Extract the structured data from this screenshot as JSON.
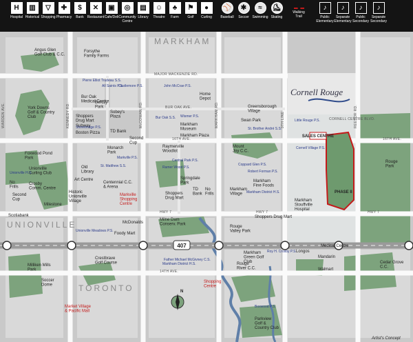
{
  "legend": [
    {
      "icon": "hospital-icon",
      "glyph": "H",
      "label": "Hospital"
    },
    {
      "icon": "historical-icon",
      "glyph": "▥",
      "label": "Historical"
    },
    {
      "icon": "shopping-cart-icon",
      "glyph": "▽",
      "label": "Shopping"
    },
    {
      "icon": "pharmacy-icon",
      "glyph": "✚",
      "label": "Pharmacy"
    },
    {
      "icon": "bank-icon",
      "glyph": "$",
      "label": "Bank"
    },
    {
      "icon": "restaurant-icon",
      "glyph": "✕",
      "label": "Restaurant"
    },
    {
      "icon": "coffee-icon",
      "glyph": "▣",
      "label": "Cafe/Deli"
    },
    {
      "icon": "community-centre-icon",
      "glyph": "◎",
      "label": "Community Centre"
    },
    {
      "icon": "library-icon",
      "glyph": "▤",
      "label": "Library"
    },
    {
      "icon": "theatre-icon",
      "glyph": "☺",
      "label": "Theatre"
    },
    {
      "icon": "farm-icon",
      "glyph": "♣",
      "label": "Farm"
    },
    {
      "icon": "golf-icon",
      "glyph": "⚑",
      "label": "Golf"
    },
    {
      "icon": "curling-icon",
      "glyph": "●",
      "label": "Curling"
    },
    {
      "icon": "baseball-icon",
      "glyph": "⚾",
      "label": "Baseball"
    },
    {
      "icon": "soccer-icon",
      "glyph": "✱",
      "label": "Soccer"
    },
    {
      "icon": "swimming-icon",
      "glyph": "≈",
      "label": "Swimming"
    },
    {
      "icon": "skating-icon",
      "glyph": "⛸",
      "label": "Skating"
    },
    {
      "icon": "walking-trail-icon",
      "glyph": "",
      "label": "Walking Trail"
    },
    {
      "icon": "public-elementary-icon",
      "glyph": "♪",
      "label": "Public Elementary"
    },
    {
      "icon": "separate-elementary-icon",
      "glyph": "♪",
      "label": "Separate Elementary"
    },
    {
      "icon": "public-secondary-icon",
      "glyph": "♪",
      "label": "Public Secondary"
    },
    {
      "icon": "separate-secondary-icon",
      "glyph": "♪",
      "label": "Separate Secondary"
    }
  ],
  "regions": {
    "markham": "MARKHAM",
    "unionville": "UNIONVILLE",
    "toronto": "TORONTO"
  },
  "brand": {
    "name": "Cornell Rouge",
    "sales_centre": "SALES CENTRE",
    "phase": "PHASE II"
  },
  "roads": {
    "major_mackenzie": "MAJOR MACKENZIE RD.",
    "bur_oak": "BUR OAK AVE.",
    "sixteenth_top": "16TH AVE.",
    "sixteenth_mid": "16TH AVE.",
    "hwy7_a": "HWY 7",
    "hwy7_b": "HWY 7",
    "hwy7_c": "HWY 7",
    "fourteenth": "14TH AVE.",
    "warden": "WARDEN AVE.",
    "kennedy": "KENNEDY RD.",
    "mccowan": "McCOWAN RD.",
    "markham_rd": "MARKHAM RD.",
    "ninth_line": "9TH LINE",
    "reesor": "REESOR RD.",
    "cornell_centre": "CORNELL CENTRE BLVD.",
    "hwy407": "407"
  },
  "places": [
    {
      "t": "Angus Glen",
      "s": "Golf Club & C.C."
    },
    {
      "t": "Forsythe",
      "s": "Family Farms"
    },
    {
      "t": "York Downs",
      "s": "Golf & Country",
      "s2": "Club"
    },
    {
      "t": "Bur Oak",
      "s": "Medical Centre"
    },
    {
      "t": "Berczy",
      "s": "Park"
    },
    {
      "t": "Home",
      "s": "Depot"
    },
    {
      "t": "Greensborough",
      "s": "Village"
    },
    {
      "t": "Swan Park"
    },
    {
      "t": "Shoppers",
      "s": "Drug Mart"
    },
    {
      "t": "Subway"
    },
    {
      "t": "Boston Pizza"
    },
    {
      "t": "Sobey's",
      "s": "Plaza"
    },
    {
      "t": "TD Bank"
    },
    {
      "t": "Second",
      "s": "Cup"
    },
    {
      "t": "Markham",
      "s": "Museum"
    },
    {
      "t": "Markham Plaza"
    },
    {
      "t": "Mount",
      "s": "Joy C.C."
    },
    {
      "t": "Monarch",
      "s": "Park"
    },
    {
      "t": "Old",
      "s": "Library"
    },
    {
      "t": "Raymerville",
      "s": "Woodlot"
    },
    {
      "t": "Springdale",
      "s": "Park"
    },
    {
      "t": "Markham",
      "s": "Fine Foods"
    },
    {
      "t": "Foxwood Pond",
      "s": "Park"
    },
    {
      "t": "Unionville",
      "s": "Curling Club"
    },
    {
      "t": "Crosby",
      "s": "Comm. Centre"
    },
    {
      "t": "No",
      "s": "Frills"
    },
    {
      "t": "Art Centre"
    },
    {
      "t": "Historic",
      "s": "Unionville",
      "s2": "Village"
    },
    {
      "t": "Centennial C.C.",
      "s": "& Arena"
    },
    {
      "t": "Markville",
      "s": "Shopping",
      "s2": "Centre"
    },
    {
      "t": "Shoppers",
      "s": "Drug Mart"
    },
    {
      "t": "TD",
      "s": "Bank"
    },
    {
      "t": "No",
      "s": "Frills"
    },
    {
      "t": "Markham",
      "s": "Village"
    },
    {
      "t": "Markham",
      "s": "Stouffville",
      "s2": "Hospital"
    },
    {
      "t": "Rouge",
      "s": "Park"
    },
    {
      "t": "Second",
      "s": "Cup"
    },
    {
      "t": "Milestone"
    },
    {
      "t": "Scotiabank"
    },
    {
      "t": "McDonalds"
    },
    {
      "t": "Foody Mart"
    },
    {
      "t": "Milne Dam",
      "s": "Conserv. Park"
    },
    {
      "t": "Shoppers Drug Mart"
    },
    {
      "t": "Rouge",
      "s": "Valley Park"
    },
    {
      "t": "Crestbrave",
      "s": "Golf Course"
    },
    {
      "t": "Markham",
      "s": "Green Golf",
      "s2": "Club"
    },
    {
      "t": "Rouge",
      "s": "River C.C."
    },
    {
      "t": "Longos"
    },
    {
      "t": "Medical Centre"
    },
    {
      "t": "Mandarin"
    },
    {
      "t": "Walmart"
    },
    {
      "t": "Cedar Grove",
      "s": "C.C."
    },
    {
      "t": "Milliken Mills",
      "s": "Park"
    },
    {
      "t": "Soccer",
      "s": "Dome"
    },
    {
      "t": "Shopping",
      "s": "Centre"
    },
    {
      "t": "Market Village",
      "s": "& Pacific Mall"
    },
    {
      "t": "Parkview",
      "s": "Golf &",
      "s2": "Country Club"
    }
  ],
  "schools": [
    "Pierre Elliot Trudeau S.S.",
    "All Saints P.S.",
    "Castlemore P.S.",
    "John McCrae P.S.",
    "Bur Oak S.S.",
    "Wismer P.S.",
    "Stonebridge P.S.",
    "St. Brother André S.S.",
    "Little Rouge P.S.",
    "Cornell Village P.S.",
    "Markville P.S.",
    "St. Matthew S.S.",
    "Central Park P.S.",
    "Coppard Glen P.S.",
    "Ramer Wood P.S.",
    "Robert Forman P.S.",
    "Markham District H.S.",
    "Unionville H.S.",
    "Unionville Meadows P.S.",
    "Father Michael McGivney C.S.",
    "Markham District H.S.",
    "Roy H. Crosby P.S.",
    "Boxwood P.S."
  ],
  "credit": "Artist's Concept"
}
